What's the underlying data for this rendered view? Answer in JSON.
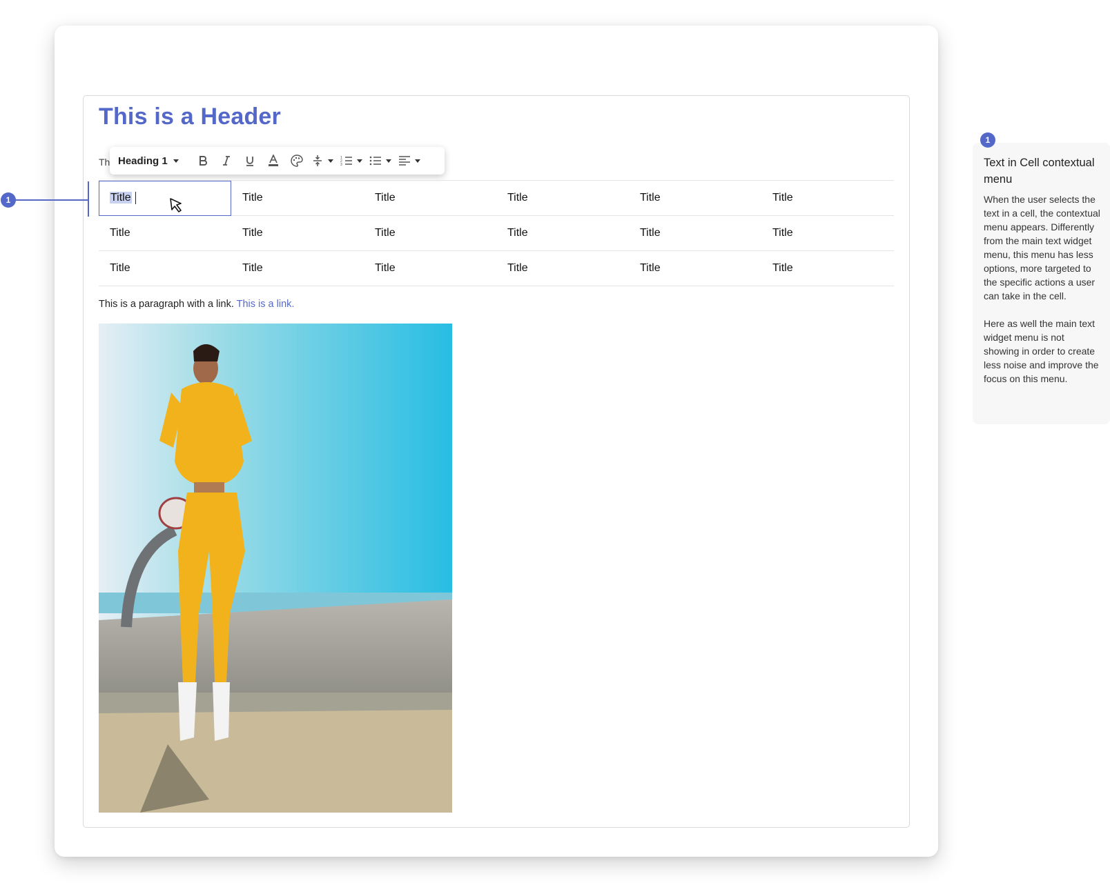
{
  "document": {
    "header": "This is a Header",
    "hidden_text_fragment": "Th",
    "paragraph_text": "This is a paragraph with a link.",
    "link_text": "This is a link."
  },
  "toolbar": {
    "style_label": "Heading 1",
    "buttons": [
      "bold-icon",
      "italic-icon",
      "underline-icon",
      "text-color-icon",
      "palette-icon",
      "line-height-icon",
      "numbered-list-icon",
      "bulleted-list-icon",
      "align-left-icon"
    ]
  },
  "table": {
    "rows": [
      [
        "Title",
        "Title",
        "Title",
        "Title",
        "Title",
        "Title"
      ],
      [
        "Title",
        "Title",
        "Title",
        "Title",
        "Title",
        "Title"
      ],
      [
        "Title",
        "Title",
        "Title",
        "Title",
        "Title",
        "Title"
      ]
    ],
    "selected_cell_text": "Title"
  },
  "annotation": {
    "number": "1",
    "title": "Text in Cell contextual menu",
    "body": "When the user selects the text in a cell, the contextual menu appears. Differently from the main text widget menu, this menu has less options, more targeted to the specific actions a user can take in the cell.\n\nHere as well the main text widget menu is not showing in order to create less noise and improve the focus on this menu."
  },
  "colors": {
    "accent": "#5468c9",
    "outfit": "#f2b21c",
    "sky": "#4cc3de"
  }
}
